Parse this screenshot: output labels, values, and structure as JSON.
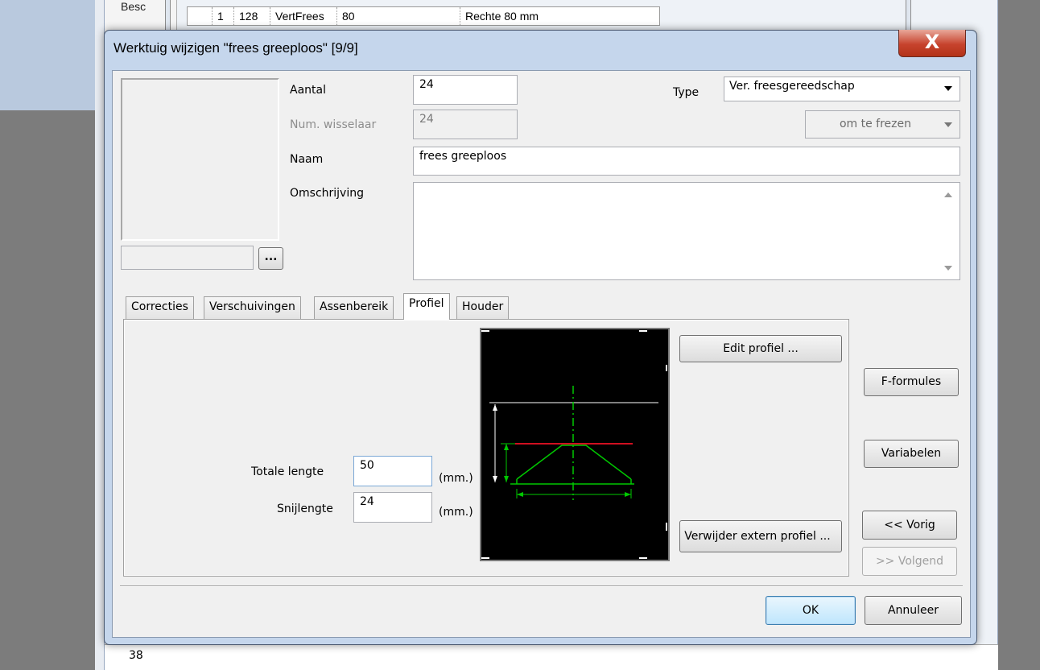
{
  "background": {
    "row_label": "Besc",
    "grid_row": [
      "1",
      "128",
      "VertFrees",
      "80",
      "Rechte 80 mm"
    ],
    "bottom_label": "38"
  },
  "dialog": {
    "title": "Werktuig wijzigen \"frees greeploos\" [9/9]",
    "close_glyph": "X",
    "preview": {
      "browse_label": "..."
    },
    "fields": {
      "aantal_label": "Aantal",
      "aantal_value": "24",
      "num_wisselaar_label": "Num. wisselaar",
      "num_wisselaar_value": "24",
      "naam_label": "Naam",
      "naam_value": "frees greeploos",
      "omschrijving_label": "Omschrijving",
      "omschrijving_value": "",
      "type_label": "Type",
      "type_value": "Ver. freesgereedschap",
      "subtype_value": "om te frezen"
    },
    "tabs": [
      {
        "label": "Correcties"
      },
      {
        "label": "Verschuivingen"
      },
      {
        "label": "Assenbereik"
      },
      {
        "label": "Profiel"
      },
      {
        "label": "Houder"
      }
    ],
    "profiel": {
      "totale_lengte_label": "Totale lengte",
      "totale_lengte_value": "50",
      "snijlengte_label": "Snijlengte",
      "snijlengte_value": "24",
      "unit": "(mm.)",
      "edit_button": "Edit profiel ...",
      "remove_button": "Verwijder extern profiel ...",
      "colors": {
        "canvas": "#000000",
        "outline": "#00c800",
        "top_line": "#ffffff",
        "cut_line": "#d01020"
      }
    },
    "side_buttons": {
      "f_formules": "F-formules",
      "variabelen": "Variabelen",
      "vorig": "<< Vorig",
      "volgend": ">> Volgend"
    },
    "footer": {
      "ok": "OK",
      "cancel": "Annuleer"
    }
  }
}
